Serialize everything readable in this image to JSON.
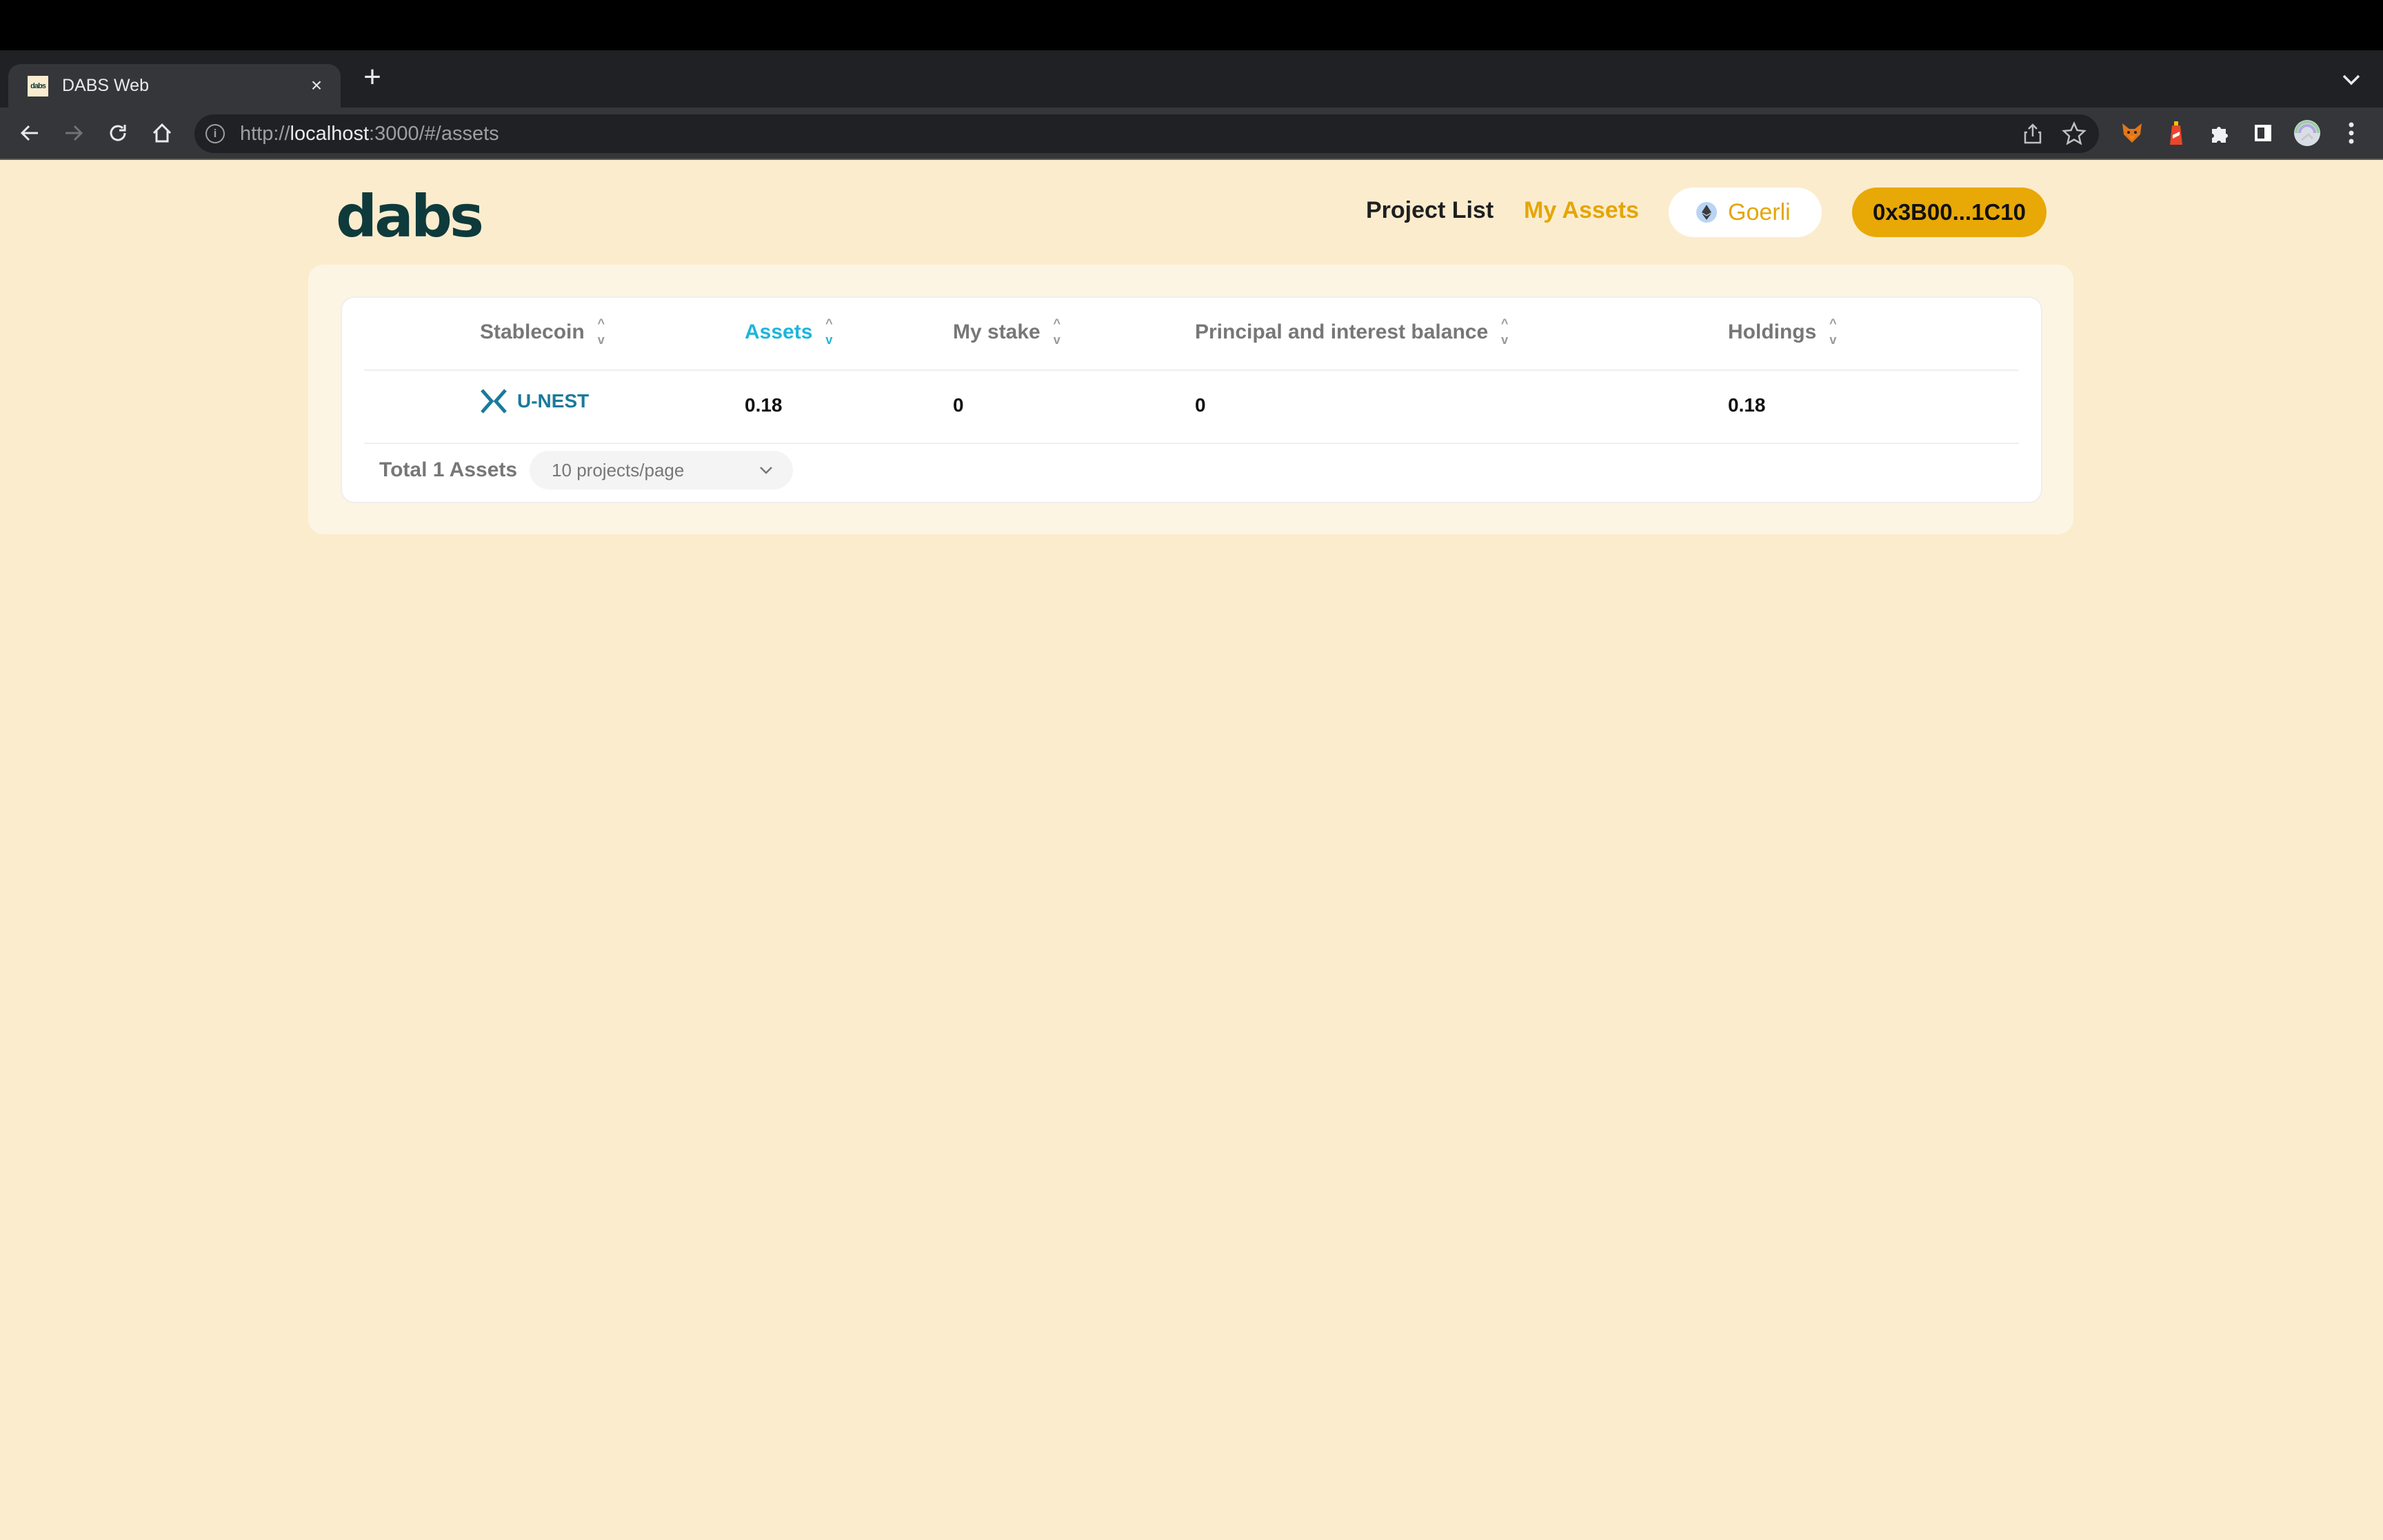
{
  "browser": {
    "tab_title": "DABS Web",
    "tab_favicon_text": "dabs",
    "close_glyph": "×",
    "new_tab_glyph": "+",
    "url_scheme": "http://",
    "url_host": "localhost",
    "url_path": ":3000/#/assets",
    "info_glyph": "i"
  },
  "header": {
    "logo": "dabs",
    "nav": {
      "project_list": "Project List",
      "my_assets": "My Assets"
    },
    "network": "Goerli",
    "wallet": "0x3B00...1C10"
  },
  "table": {
    "columns": [
      {
        "label": "Stablecoin",
        "active": false
      },
      {
        "label": "Assets",
        "active": true
      },
      {
        "label": "My stake",
        "active": false
      },
      {
        "label": "Principal and interest balance",
        "active": false
      },
      {
        "label": "Holdings",
        "active": false
      }
    ],
    "sort_up_glyph": "^",
    "sort_down_glyph": "v",
    "rows": [
      {
        "stablecoin": "U-NEST",
        "assets": "0.18",
        "my_stake": "0",
        "principal_and_interest_balance": "0",
        "holdings": "0.18"
      }
    ]
  },
  "footer": {
    "total": "Total 1 Assets",
    "page_size": "10 projects/page"
  },
  "colors": {
    "page_bg": "#fbecce",
    "accent_gold": "#e8a806",
    "active_sort": "#1fb5d9",
    "brand_dark": "#0e3a3c",
    "coin_teal": "#1b7a9a"
  }
}
